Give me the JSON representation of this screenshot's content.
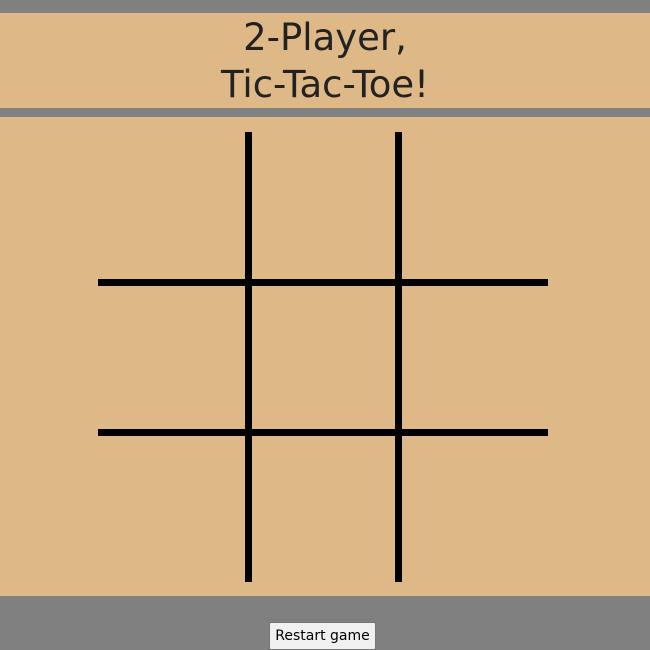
{
  "header": {
    "title_line1": "2-Player,",
    "title_line2": "Tic-Tac-Toe!"
  },
  "board": {
    "cells": [
      [
        "",
        "",
        ""
      ],
      [
        "",
        "",
        ""
      ],
      [
        "",
        "",
        ""
      ]
    ]
  },
  "footer": {
    "restart_label": "Restart game"
  },
  "colors": {
    "page_background": "#808080",
    "panel_background": "#DEB887",
    "grid_lines": "#000000",
    "title_text": "#222222"
  }
}
